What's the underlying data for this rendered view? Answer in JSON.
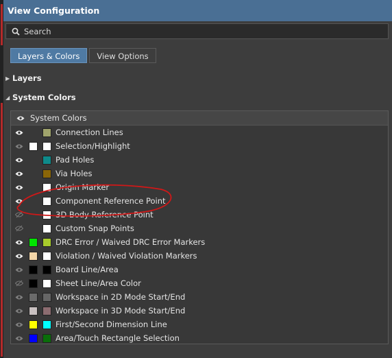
{
  "window": {
    "title": "View Configuration"
  },
  "search": {
    "placeholder": "Search"
  },
  "tabs": [
    {
      "label": "Layers & Colors",
      "active": true
    },
    {
      "label": "View Options",
      "active": false
    }
  ],
  "sections": {
    "layers": {
      "label": "Layers",
      "expanded": false
    },
    "system_colors": {
      "label": "System Colors",
      "expanded": true
    }
  },
  "table": {
    "header_label": "System Colors",
    "rows": [
      {
        "label": "Connection Lines",
        "visible": true,
        "color1": null,
        "color2": "#a0a46c"
      },
      {
        "label": "Selection/Highlight",
        "visible": false,
        "color1": "#ffffff",
        "color2": "#ffffff"
      },
      {
        "label": "Pad Holes",
        "visible": true,
        "color1": null,
        "color2": "#0e8a8a"
      },
      {
        "label": "Via Holes",
        "visible": true,
        "color1": null,
        "color2": "#8a6608"
      },
      {
        "label": "Origin Marker",
        "visible": true,
        "color1": null,
        "color2": "#ffffff"
      },
      {
        "label": "Component Reference Point",
        "visible": true,
        "color1": null,
        "color2": "#ffffff"
      },
      {
        "label": "3D Body Reference Point",
        "visible": false,
        "hidden_icon": true,
        "color1": null,
        "color2": "#ffffff"
      },
      {
        "label": "Custom Snap Points",
        "visible": false,
        "hidden_icon": true,
        "color1": null,
        "color2": "#ffffff"
      },
      {
        "label": "DRC Error / Waived DRC Error Markers",
        "visible": true,
        "color1": "#00e600",
        "color2": "#a8cc2c"
      },
      {
        "label": "Violation / Waived Violation Markers",
        "visible": true,
        "color1": "#f4d6a8",
        "color2": "#ffffff"
      },
      {
        "label": "Board Line/Area",
        "visible": false,
        "color1": "#000000",
        "color2": "#000000"
      },
      {
        "label": "Sheet Line/Area Color",
        "visible": false,
        "hidden_icon": true,
        "color1": "#000000",
        "color2": "#ffffff"
      },
      {
        "label": "Workspace in 2D Mode Start/End",
        "visible": false,
        "color1": "#6a6a6a",
        "color2": "#666666"
      },
      {
        "label": "Workspace in 3D Mode Start/End",
        "visible": false,
        "color1": "#c8c0c0",
        "color2": "#8c6c70"
      },
      {
        "label": "First/Second Dimension Line",
        "visible": false,
        "color1": "#ffff00",
        "color2": "#00ffff"
      },
      {
        "label": "Area/Touch Rectangle Selection",
        "visible": false,
        "color1": "#0000ff",
        "color2": "#0a6e0a"
      }
    ]
  },
  "annotation": {
    "type": "red-ellipse",
    "around": "Component Reference Point",
    "color": "#d01818"
  },
  "colors": {
    "titlebar": "#4a6f94",
    "active_tab": "#4f7aa3",
    "background": "#3d3d3d"
  }
}
